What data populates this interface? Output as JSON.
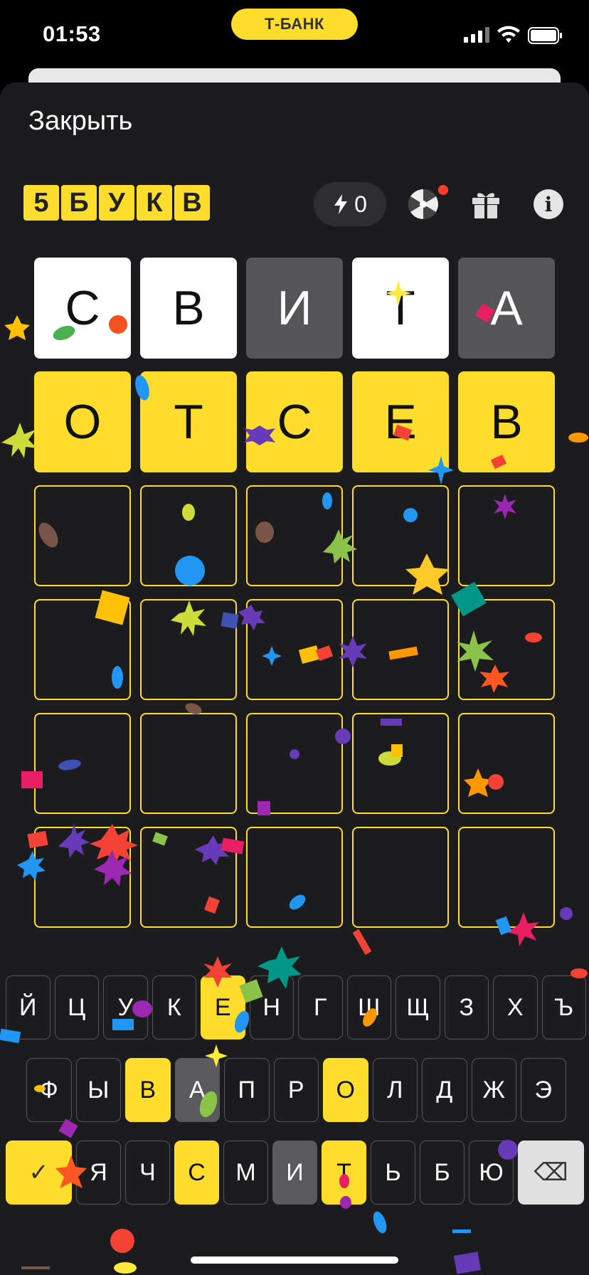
{
  "status_bar": {
    "time": "01:53",
    "bank_label": "Т-БАНК"
  },
  "sheet": {
    "close_label": "Закрыть"
  },
  "logo": {
    "letters": [
      "5",
      "Б",
      "У",
      "К",
      "В"
    ]
  },
  "toolbar": {
    "energy_count": "0",
    "info_label": "i"
  },
  "grid": {
    "rows": [
      [
        {
          "letter": "С",
          "state": "white"
        },
        {
          "letter": "В",
          "state": "white"
        },
        {
          "letter": "И",
          "state": "gray"
        },
        {
          "letter": "Т",
          "state": "white"
        },
        {
          "letter": "А",
          "state": "gray"
        }
      ],
      [
        {
          "letter": "О",
          "state": "yellow"
        },
        {
          "letter": "Т",
          "state": "yellow"
        },
        {
          "letter": "С",
          "state": "yellow"
        },
        {
          "letter": "Е",
          "state": "yellow"
        },
        {
          "letter": "В",
          "state": "yellow"
        }
      ],
      [
        {
          "letter": "",
          "state": "empty"
        },
        {
          "letter": "",
          "state": "empty"
        },
        {
          "letter": "",
          "state": "empty"
        },
        {
          "letter": "",
          "state": "empty"
        },
        {
          "letter": "",
          "state": "empty"
        }
      ],
      [
        {
          "letter": "",
          "state": "empty"
        },
        {
          "letter": "",
          "state": "empty"
        },
        {
          "letter": "",
          "state": "empty"
        },
        {
          "letter": "",
          "state": "empty"
        },
        {
          "letter": "",
          "state": "empty"
        }
      ],
      [
        {
          "letter": "",
          "state": "empty"
        },
        {
          "letter": "",
          "state": "empty"
        },
        {
          "letter": "",
          "state": "empty"
        },
        {
          "letter": "",
          "state": "empty"
        },
        {
          "letter": "",
          "state": "empty"
        }
      ],
      [
        {
          "letter": "",
          "state": "empty"
        },
        {
          "letter": "",
          "state": "empty"
        },
        {
          "letter": "",
          "state": "empty"
        },
        {
          "letter": "",
          "state": "empty"
        },
        {
          "letter": "",
          "state": "empty"
        }
      ]
    ]
  },
  "keyboard": {
    "row1": [
      {
        "k": "Й",
        "s": "default"
      },
      {
        "k": "Ц",
        "s": "default"
      },
      {
        "k": "У",
        "s": "default"
      },
      {
        "k": "К",
        "s": "default"
      },
      {
        "k": "Е",
        "s": "yellow"
      },
      {
        "k": "Н",
        "s": "default"
      },
      {
        "k": "Г",
        "s": "default"
      },
      {
        "k": "Ш",
        "s": "default"
      },
      {
        "k": "Щ",
        "s": "default"
      },
      {
        "k": "З",
        "s": "default"
      },
      {
        "k": "Х",
        "s": "default"
      },
      {
        "k": "Ъ",
        "s": "default"
      }
    ],
    "row2": [
      {
        "k": "Ф",
        "s": "default"
      },
      {
        "k": "Ы",
        "s": "default"
      },
      {
        "k": "В",
        "s": "yellow"
      },
      {
        "k": "А",
        "s": "gray"
      },
      {
        "k": "П",
        "s": "default"
      },
      {
        "k": "Р",
        "s": "default"
      },
      {
        "k": "О",
        "s": "yellow"
      },
      {
        "k": "Л",
        "s": "default"
      },
      {
        "k": "Д",
        "s": "default"
      },
      {
        "k": "Ж",
        "s": "default"
      },
      {
        "k": "Э",
        "s": "default"
      }
    ],
    "row3": [
      {
        "k": "✓",
        "s": "enter"
      },
      {
        "k": "Я",
        "s": "default"
      },
      {
        "k": "Ч",
        "s": "default"
      },
      {
        "k": "С",
        "s": "yellow"
      },
      {
        "k": "М",
        "s": "default"
      },
      {
        "k": "И",
        "s": "gray"
      },
      {
        "k": "Т",
        "s": "yellow"
      },
      {
        "k": "Ь",
        "s": "default"
      },
      {
        "k": "Б",
        "s": "default"
      },
      {
        "k": "Ю",
        "s": "default"
      },
      {
        "k": "⌫",
        "s": "back"
      }
    ]
  },
  "colors": {
    "accent": "#ffdd2d",
    "background": "#1c1c1e",
    "absent": "#555557"
  }
}
